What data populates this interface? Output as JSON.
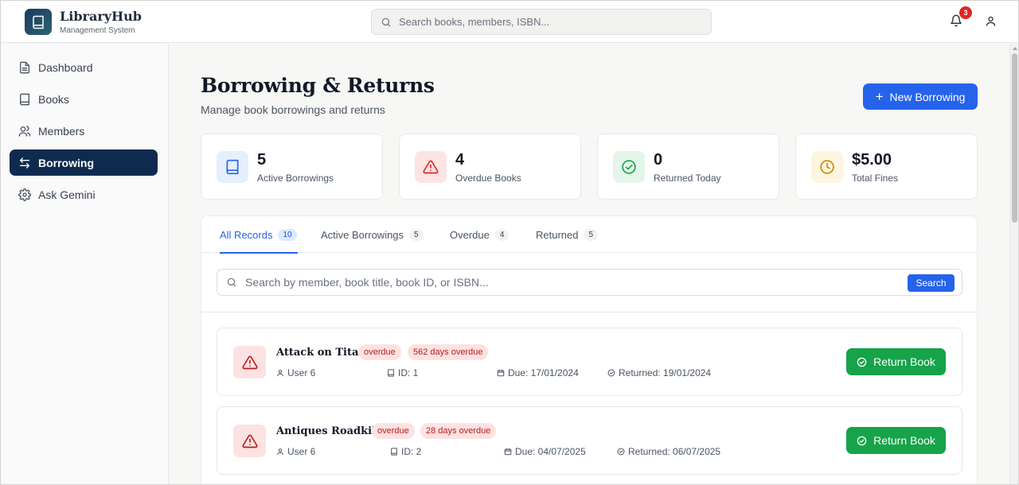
{
  "app": {
    "name": "LibraryHub",
    "subtitle": "Management System"
  },
  "header": {
    "search_placeholder": "Search books, members, ISBN...",
    "notification_count": "3"
  },
  "sidebar": {
    "items": [
      {
        "label": "Dashboard",
        "icon": "file-text-icon"
      },
      {
        "label": "Books",
        "icon": "book-icon"
      },
      {
        "label": "Members",
        "icon": "users-icon"
      },
      {
        "label": "Borrowing",
        "icon": "arrows-left-right-icon",
        "active": true
      },
      {
        "label": "Ask Gemini",
        "icon": "gear-icon"
      }
    ]
  },
  "page": {
    "title": "Borrowing & Returns",
    "subtitle": "Manage book borrowings and returns",
    "new_button": "New Borrowing"
  },
  "stats": [
    {
      "value": "5",
      "label": "Active Borrowings",
      "icon": "book-icon",
      "color": "#2563eb"
    },
    {
      "value": "4",
      "label": "Overdue Books",
      "icon": "alert-triangle-icon",
      "color": "#dc2626"
    },
    {
      "value": "0",
      "label": "Returned Today",
      "icon": "check-circle-icon",
      "color": "#16a34a"
    },
    {
      "value": "$5.00",
      "label": "Total Fines",
      "icon": "clock-icon",
      "color": "#ca8a04"
    }
  ],
  "tabs": [
    {
      "label": "All Records",
      "count": "10",
      "active": true
    },
    {
      "label": "Active Borrowings",
      "count": "5"
    },
    {
      "label": "Overdue",
      "count": "4"
    },
    {
      "label": "Returned",
      "count": "5"
    }
  ],
  "records_search": {
    "placeholder": "Search by member, book title, book ID, or ISBN...",
    "button": "Search"
  },
  "records": [
    {
      "title": "Attack on Titan",
      "status": "overdue",
      "overdue_text": "562 days overdue",
      "member": "User 6",
      "book_id": "ID: 1",
      "due": "Due: 17/01/2024",
      "returned": "Returned: 19/01/2024",
      "action": "Return Book"
    },
    {
      "title": "Antiques Roadkill",
      "status": "overdue",
      "overdue_text": "28 days overdue",
      "member": "User 6",
      "book_id": "ID: 2",
      "due": "Due: 04/07/2025",
      "returned": "Returned: 06/07/2025",
      "action": "Return Book"
    }
  ],
  "colors": {
    "primary": "#2563eb",
    "sidebar_active": "#0f2a4f",
    "success": "#16a34a",
    "danger": "#dc2626"
  }
}
